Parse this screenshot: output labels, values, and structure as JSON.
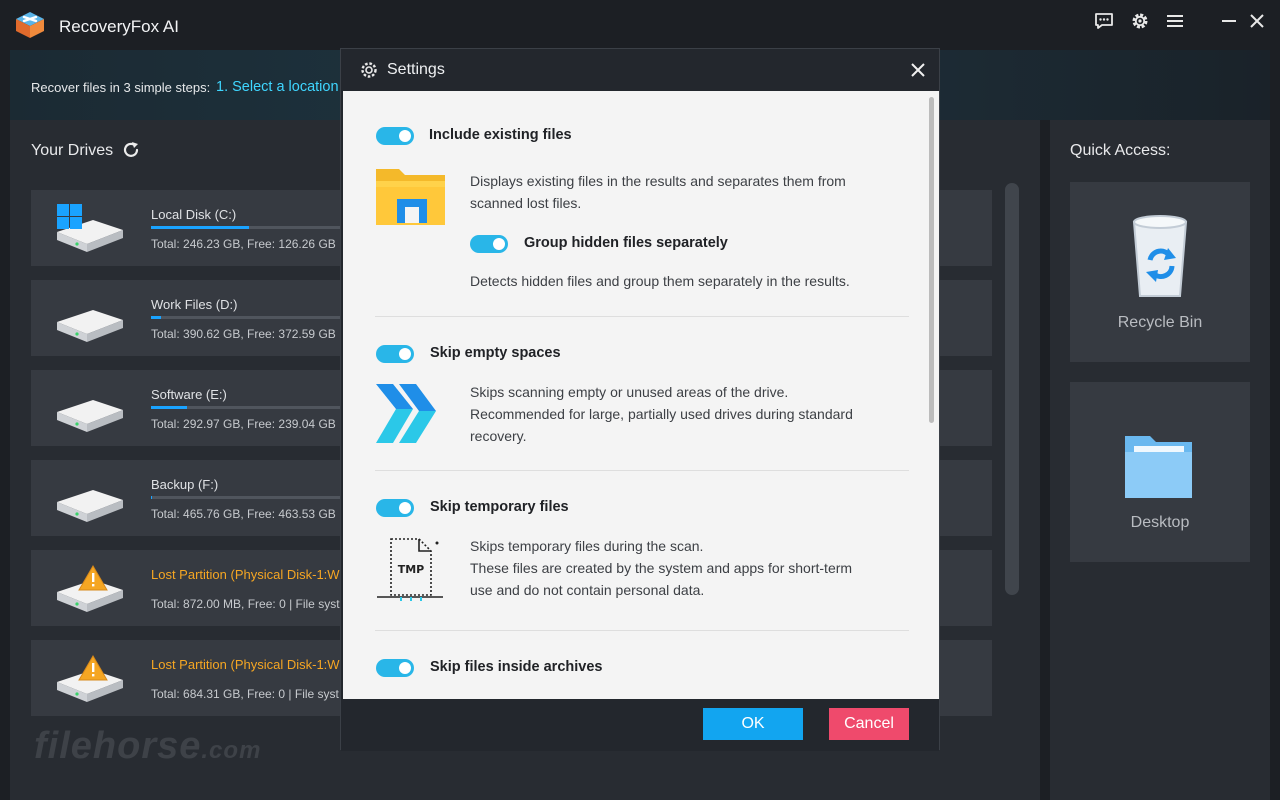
{
  "app": {
    "title": "RecoveryFox AI"
  },
  "titlebar": {
    "feedback_icon": "feedback-icon",
    "settings_icon": "gear-icon",
    "menu_icon": "menu-icon",
    "minimize_icon": "minimize-icon",
    "close_icon": "close-icon"
  },
  "steps": {
    "prefix": "Recover files in 3 simple steps:",
    "step1": "1. Select a location"
  },
  "drives": {
    "title": "Your Drives",
    "refresh_icon": "refresh-icon",
    "items": [
      {
        "name": "Local Disk (C:)",
        "info": "Total: 246.23 GB, Free: 126.26 GB",
        "used": 0.49,
        "lost": false
      },
      {
        "name": "Work Files (D:)",
        "info": "Total: 390.62 GB, Free: 372.59 GB",
        "used": 0.05,
        "lost": false
      },
      {
        "name": "Software (E:)",
        "info": "Total: 292.97 GB, Free: 239.04 GB",
        "used": 0.18,
        "lost": false
      },
      {
        "name": "Backup (F:)",
        "info": "Total: 465.76 GB, Free: 463.53 GB",
        "used": 0.005,
        "lost": false
      },
      {
        "name": "Lost Partition (Physical Disk-1:W",
        "info": "Total: 872.00 MB, Free: 0 | File syst",
        "used": 0,
        "lost": true
      },
      {
        "name": "Lost Partition (Physical Disk-1:W",
        "info": "Total: 684.31 GB, Free: 0 | File syst",
        "used": 0,
        "lost": true
      }
    ]
  },
  "watermark": {
    "text": "filehorse",
    "suffix": ".com"
  },
  "quick_access": {
    "title": "Quick Access:",
    "items": [
      {
        "label": "Recycle Bin",
        "icon": "recycle-bin-icon"
      },
      {
        "label": "Desktop",
        "icon": "folder-icon"
      }
    ]
  },
  "settings": {
    "title": "Settings",
    "options": [
      {
        "title": "Include existing files",
        "enabled": true,
        "desc": [
          "Displays existing files in the results and separates them from",
          "scanned lost files."
        ],
        "sub": {
          "title": "Group hidden files separately",
          "enabled": true,
          "desc": "Detects hidden files and group them separately in the results."
        }
      },
      {
        "title": "Skip empty spaces",
        "enabled": true,
        "desc": [
          "Skips scanning empty or unused areas of the drive.",
          "Recommended for large, partially used drives during standard",
          "recovery."
        ]
      },
      {
        "title": "Skip temporary files",
        "enabled": true,
        "icon_text": "TMP",
        "desc": [
          "Skips temporary files during the scan.",
          "These files are created by the system and apps for short-term",
          "use and do not contain personal data."
        ]
      },
      {
        "title": "Skip files inside archives",
        "enabled": true
      }
    ],
    "ok_label": "OK",
    "cancel_label": "Cancel"
  },
  "colors": {
    "accent": "#29b6e8",
    "ok": "#12a5f0",
    "cancel": "#ef4a6c",
    "lost_partition": "#f5a623",
    "usage_bar": "#1aa3ff"
  }
}
